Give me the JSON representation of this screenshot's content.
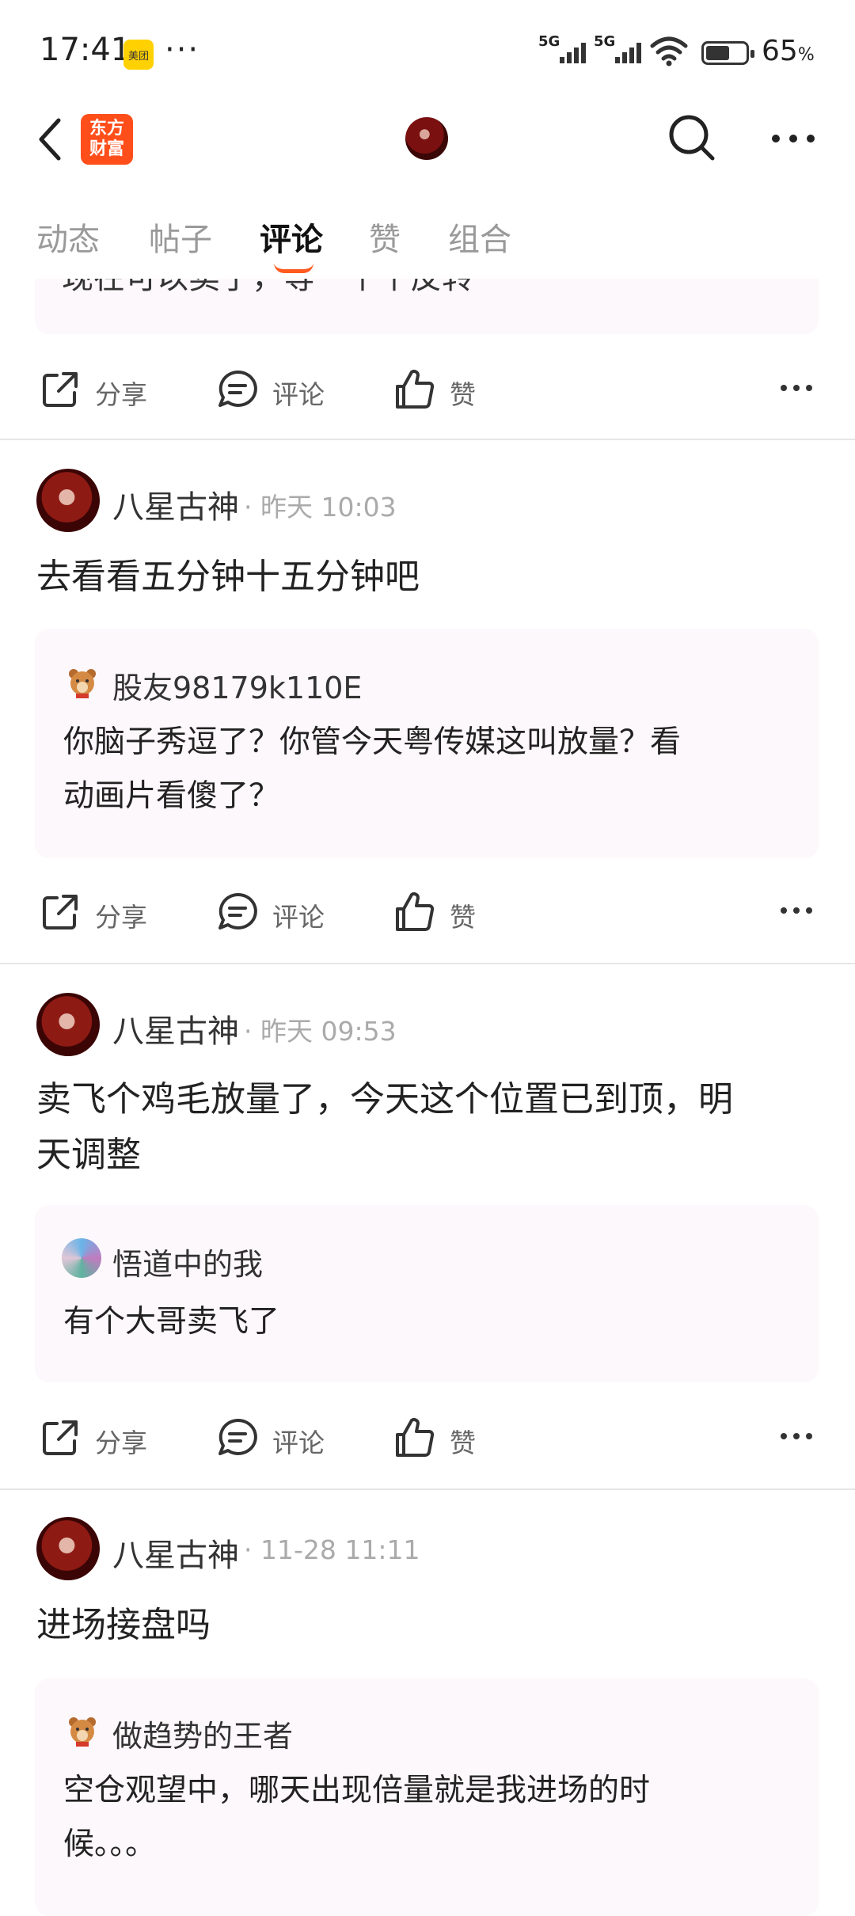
{
  "status": {
    "time": "17:41",
    "meituan": "美团",
    "dots": "···",
    "network1": "5G",
    "network2": "5G",
    "battery_percent": "65",
    "battery_level": 0.65,
    "battery_suffix": "%"
  },
  "header": {
    "logo_text_line1": "东方",
    "logo_text_line2": "财富"
  },
  "tabs": [
    {
      "label": "动态",
      "active": false
    },
    {
      "label": "帖子",
      "active": false
    },
    {
      "label": "评论",
      "active": true
    },
    {
      "label": "赞",
      "active": false
    },
    {
      "label": "组合",
      "active": false
    }
  ],
  "truncated_post": {
    "partial_text": "现在可以卖了，等一个个反转"
  },
  "actions": {
    "share": "分享",
    "comment": "评论",
    "like": "赞"
  },
  "posts": [
    {
      "user": "八星古神",
      "time": "· 昨天 10:03",
      "text": "去看看五分钟十五分钟吧",
      "quote_user": "股友98179k110E",
      "quote_text_line1": "你脑子秀逗了？你管今天粤传媒这叫放量？看",
      "quote_text_line2": "动画片看傻了？"
    },
    {
      "user": "八星古神",
      "time": "· 昨天 09:53",
      "text_line1": "卖飞个鸡毛放量了，今天这个位置已到顶，明",
      "text_line2": "天调整",
      "quote_user": "悟道中的我",
      "quote_text_line1": "有个大哥卖飞了"
    },
    {
      "user": "八星古神",
      "time": "· 11-28 11:11",
      "text": "进场接盘吗",
      "quote_user": "做趋势的王者",
      "quote_text_line1": "空仓观望中，哪天出现倍量就是我进场的时",
      "quote_text_line2": "候。。。"
    }
  ],
  "colors": {
    "accent": "#ff5a1f",
    "logo_bg": "#ff4e1a",
    "quote_bg": "#fdf8fb"
  }
}
